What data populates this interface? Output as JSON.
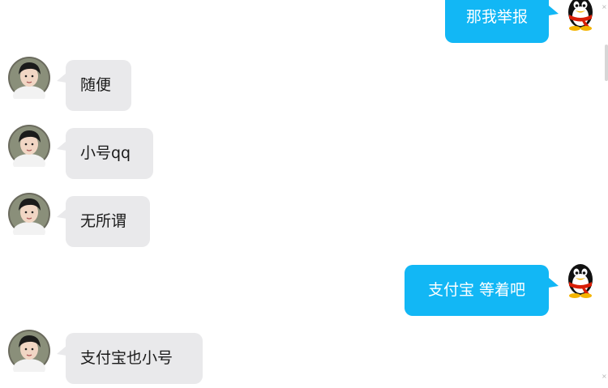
{
  "messages": [
    {
      "side": "right",
      "text": "那我举报",
      "avatar": "qq-penguin-avatar"
    },
    {
      "side": "left",
      "text": "随便",
      "avatar": "user-photo-avatar"
    },
    {
      "side": "left",
      "text": "小号qq",
      "avatar": "user-photo-avatar"
    },
    {
      "side": "left",
      "text": "无所谓",
      "avatar": "user-photo-avatar"
    },
    {
      "side": "right",
      "text": "支付宝 等着吧",
      "avatar": "qq-penguin-avatar"
    },
    {
      "side": "left",
      "text": "支付宝也小号",
      "avatar": "user-photo-avatar"
    }
  ],
  "colors": {
    "sent_bubble": "#12b7f5",
    "received_bubble": "#e9e9eb",
    "sent_text": "#ffffff",
    "received_text": "#1a1a1a"
  }
}
